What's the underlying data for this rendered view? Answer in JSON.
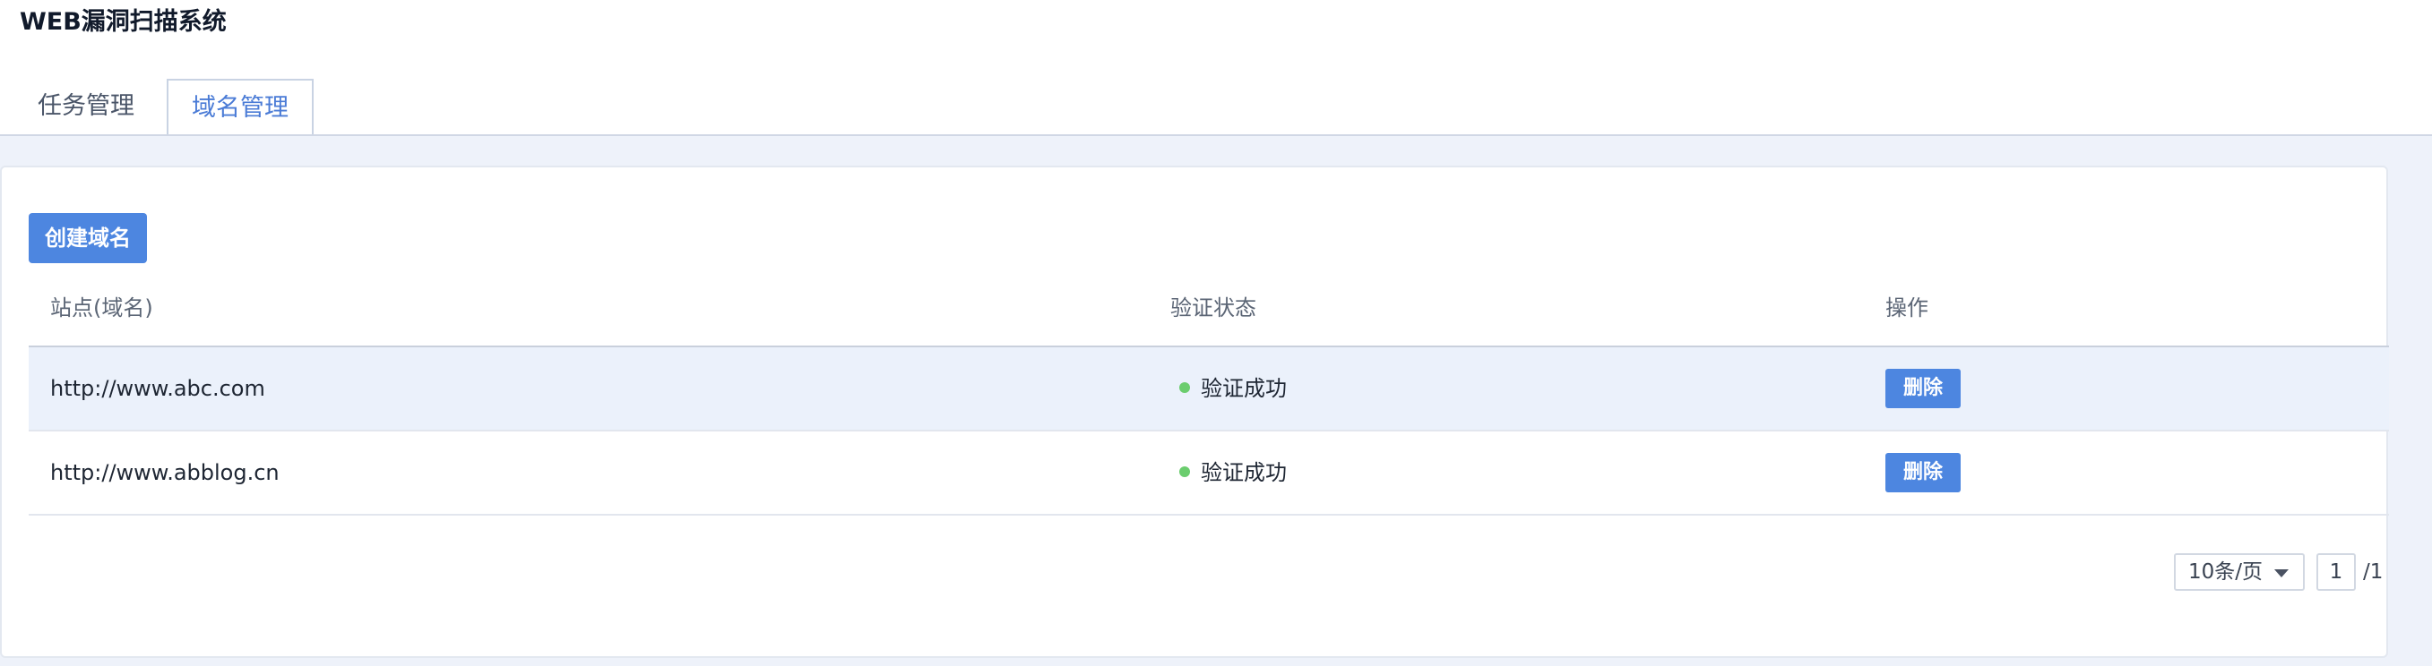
{
  "app": {
    "title": "WEB漏洞扫描系统"
  },
  "tabs": [
    {
      "label": "任务管理",
      "active": false
    },
    {
      "label": "域名管理",
      "active": true
    }
  ],
  "toolbar": {
    "create_label": "创建域名"
  },
  "table": {
    "headers": [
      "站点(域名)",
      "验证状态",
      "操作"
    ],
    "rows": [
      {
        "site": "http://www.abc.com",
        "status": "验证成功",
        "action": "删除"
      },
      {
        "site": "http://www.abblog.cn",
        "status": "验证成功",
        "action": "删除"
      }
    ]
  },
  "pagination": {
    "page_size": "10条/页",
    "current_page": "1",
    "total": "/1"
  },
  "colors": {
    "accent": "#4d86e0",
    "success": "#6bcd6e",
    "row_highlight": "#ebf1fb",
    "page_bg": "#eef2fa"
  }
}
